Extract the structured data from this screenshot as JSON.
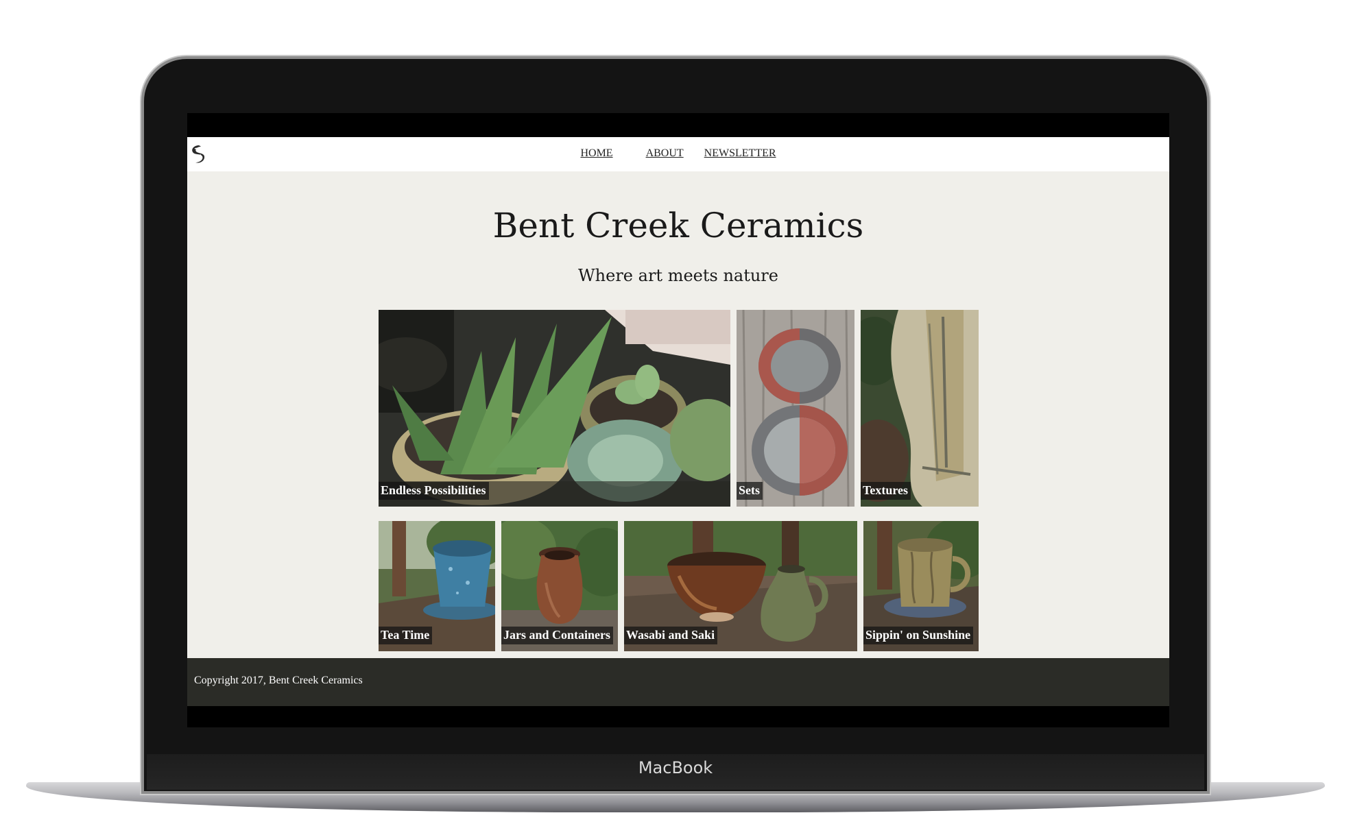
{
  "device": {
    "brand_label": "MacBook"
  },
  "site": {
    "logo_icon": "bent-creek-swirl-logo",
    "nav": {
      "home": "HOME",
      "about": "ABOUT",
      "newsletter": "NEWSLETTER"
    },
    "title": "Bent Creek Ceramics",
    "tagline": "Where art meets nature",
    "gallery": [
      {
        "caption": "Endless Possibilities"
      },
      {
        "caption": "Sets"
      },
      {
        "caption": "Textures"
      },
      {
        "caption": "Tea Time"
      },
      {
        "caption": "Jars and Containers"
      },
      {
        "caption": "Wasabi and Saki"
      },
      {
        "caption": "Sippin' on Sunshine"
      }
    ],
    "footer": {
      "copyright": "Copyright 2017, Bent Creek Ceramics"
    }
  },
  "colors": {
    "page_background": "#f0efea",
    "nav_background": "#ffffff",
    "footer_background": "#2b2c27",
    "caption_background": "#141414"
  }
}
